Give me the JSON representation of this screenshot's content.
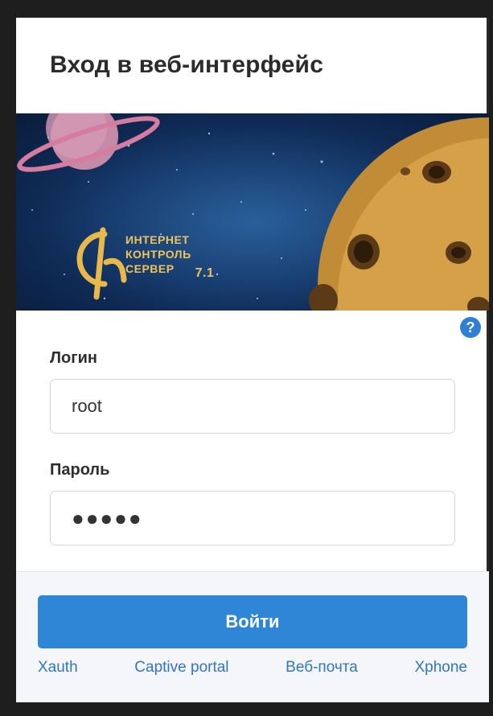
{
  "header": {
    "title": "Вход в веб-интерфейс"
  },
  "banner": {
    "logo_line1": "ИНТЕРНЕТ",
    "logo_line2": "КОНТРОЛЬ",
    "logo_line3": "СЕРВЕР",
    "version": "7.1"
  },
  "form": {
    "help_icon": "?",
    "login_label": "Логин",
    "login_value": "root",
    "password_label": "Пароль",
    "password_value": "●●●●●"
  },
  "footer": {
    "submit_label": "Войти",
    "links": [
      "Xauth",
      "Captive portal",
      "Веб-почта",
      "Xphone"
    ]
  },
  "colors": {
    "accent": "#2f86d6",
    "link": "#3076c5",
    "logo_gold": "#e8b84a"
  }
}
